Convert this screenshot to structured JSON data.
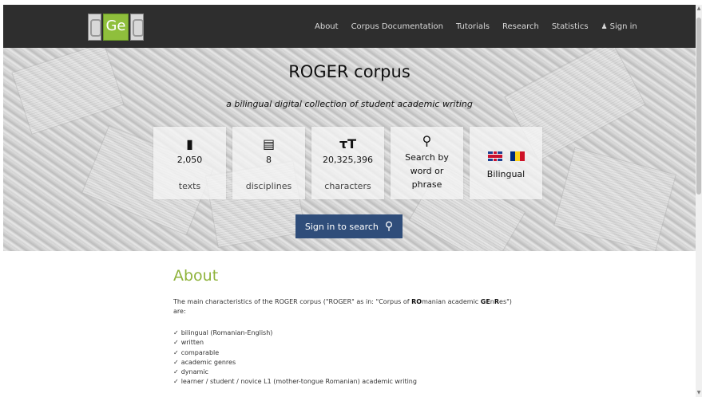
{
  "logo": {
    "letters": "Ge"
  },
  "nav": {
    "items": [
      "About",
      "Corpus Documentation",
      "Tutorials",
      "Research",
      "Statistics"
    ],
    "signin": "Sign in",
    "user_icon": "user-icon"
  },
  "hero": {
    "title": "ROGER corpus",
    "subtitle": "a bilingual digital collection of student academic writing",
    "stats": [
      {
        "icon": "document-icon",
        "value": "2,050",
        "label": "texts"
      },
      {
        "icon": "library-icon",
        "value": "8",
        "label": "disciplines"
      },
      {
        "icon": "text-size-icon",
        "value": "20,325,396",
        "label": "characters"
      }
    ],
    "search_card": {
      "icon": "search-icon",
      "line1": "Search by",
      "line2": "word or",
      "line3": "phrase"
    },
    "bilingual_card": {
      "label": "Bilingual",
      "flags": [
        "uk-flag-icon",
        "romania-flag-icon"
      ]
    },
    "search_button": "Sign in to search"
  },
  "about": {
    "title": "About",
    "intro_a": "The main characteristics of the ROGER corpus (\"ROGER\" as in: \"Corpus of ",
    "intro_ro": "RO",
    "intro_manian": "manian academic ",
    "intro_ge": "GE",
    "intro_n": "n",
    "intro_r": "R",
    "intro_es": "es\")",
    "intro_are": "are:",
    "features": [
      "bilingual (Romanian-English)",
      "written",
      "comparable",
      "academic genres",
      "dynamic",
      "learner / student / novice L1 (mother-tongue Romanian) academic writing"
    ]
  },
  "colors": {
    "navbar": "#2e2e2e",
    "accent_green": "#8fb33b",
    "button_blue": "#2f4d7a",
    "romania_blue": "#002b7f",
    "romania_yellow": "#fcd116",
    "romania_red": "#ce1126"
  }
}
